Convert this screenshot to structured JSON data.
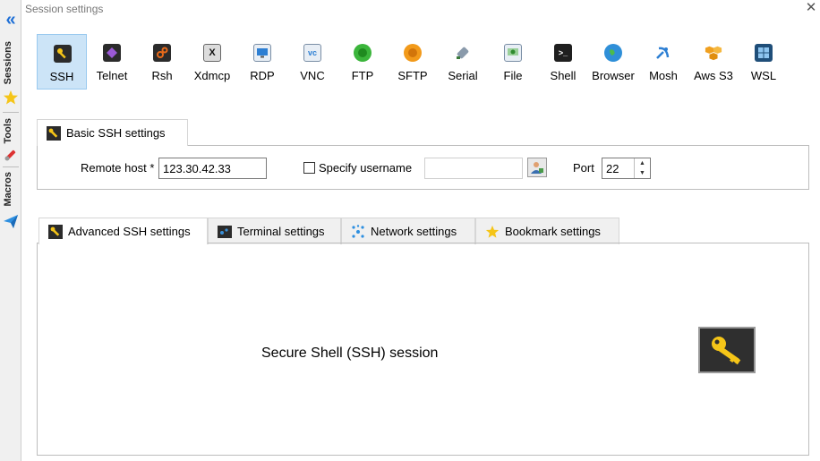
{
  "window": {
    "title": "Session settings",
    "close_glyph": "✕"
  },
  "sidebar": {
    "collapse_glyph": "«",
    "tabs": [
      {
        "label": "Sessions",
        "icon": "star-icon"
      },
      {
        "label": "Tools",
        "icon": "tools-icon"
      },
      {
        "label": "Macros",
        "icon": "paper-plane-icon"
      }
    ]
  },
  "session_types": [
    {
      "label": "SSH",
      "icon": "key-icon",
      "color": "#2b2b2b",
      "active": true
    },
    {
      "label": "Telnet",
      "icon": "telnet-icon",
      "color": "#6b3fa0"
    },
    {
      "label": "Rsh",
      "icon": "rsh-icon",
      "color": "#3a3a3a"
    },
    {
      "label": "Xdmcp",
      "icon": "x-icon",
      "color": "#555555"
    },
    {
      "label": "RDP",
      "icon": "rdp-monitor-icon",
      "color": "#2d7fd3"
    },
    {
      "label": "VNC",
      "icon": "vnc-icon",
      "color": "#2d7fd3"
    },
    {
      "label": "FTP",
      "icon": "ftp-globe-icon",
      "color": "#3bb53b"
    },
    {
      "label": "SFTP",
      "icon": "sftp-globe-icon",
      "color": "#f29a1a"
    },
    {
      "label": "Serial",
      "icon": "serial-plug-icon",
      "color": "#7a8a99"
    },
    {
      "label": "File",
      "icon": "file-monitor-icon",
      "color": "#4aa84a"
    },
    {
      "label": "Shell",
      "icon": "shell-terminal-icon",
      "color": "#1f1f1f"
    },
    {
      "label": "Browser",
      "icon": "browser-globe-icon",
      "color": "#2f8fd8"
    },
    {
      "label": "Mosh",
      "icon": "mosh-satellite-icon",
      "color": "#2d7fd3"
    },
    {
      "label": "Aws S3",
      "icon": "aws-s3-icon",
      "color": "#f0a020"
    },
    {
      "label": "WSL",
      "icon": "windows-icon",
      "color": "#1f4e79"
    }
  ],
  "basic_tab": {
    "label": "Basic SSH settings",
    "icon": "wrench-icon"
  },
  "basic": {
    "remote_host_label": "Remote host *",
    "remote_host_value": "123.30.42.33",
    "specify_username_label": "Specify username",
    "specify_username_checked": false,
    "username_value": "",
    "port_label": "Port",
    "port_value": "22",
    "user_button_icon": "user-icon"
  },
  "lower_tabs": [
    {
      "label": "Advanced SSH settings",
      "icon": "wrench-icon"
    },
    {
      "label": "Terminal settings",
      "icon": "terminal-icon"
    },
    {
      "label": "Network settings",
      "icon": "network-icon"
    },
    {
      "label": "Bookmark settings",
      "icon": "star-icon"
    }
  ],
  "description": "Secure Shell (SSH) session",
  "big_icon": "key-icon",
  "colors": {
    "active_bg": "#cce4f7",
    "accent": "#1e6fd6",
    "key_yellow": "#f5c518"
  }
}
